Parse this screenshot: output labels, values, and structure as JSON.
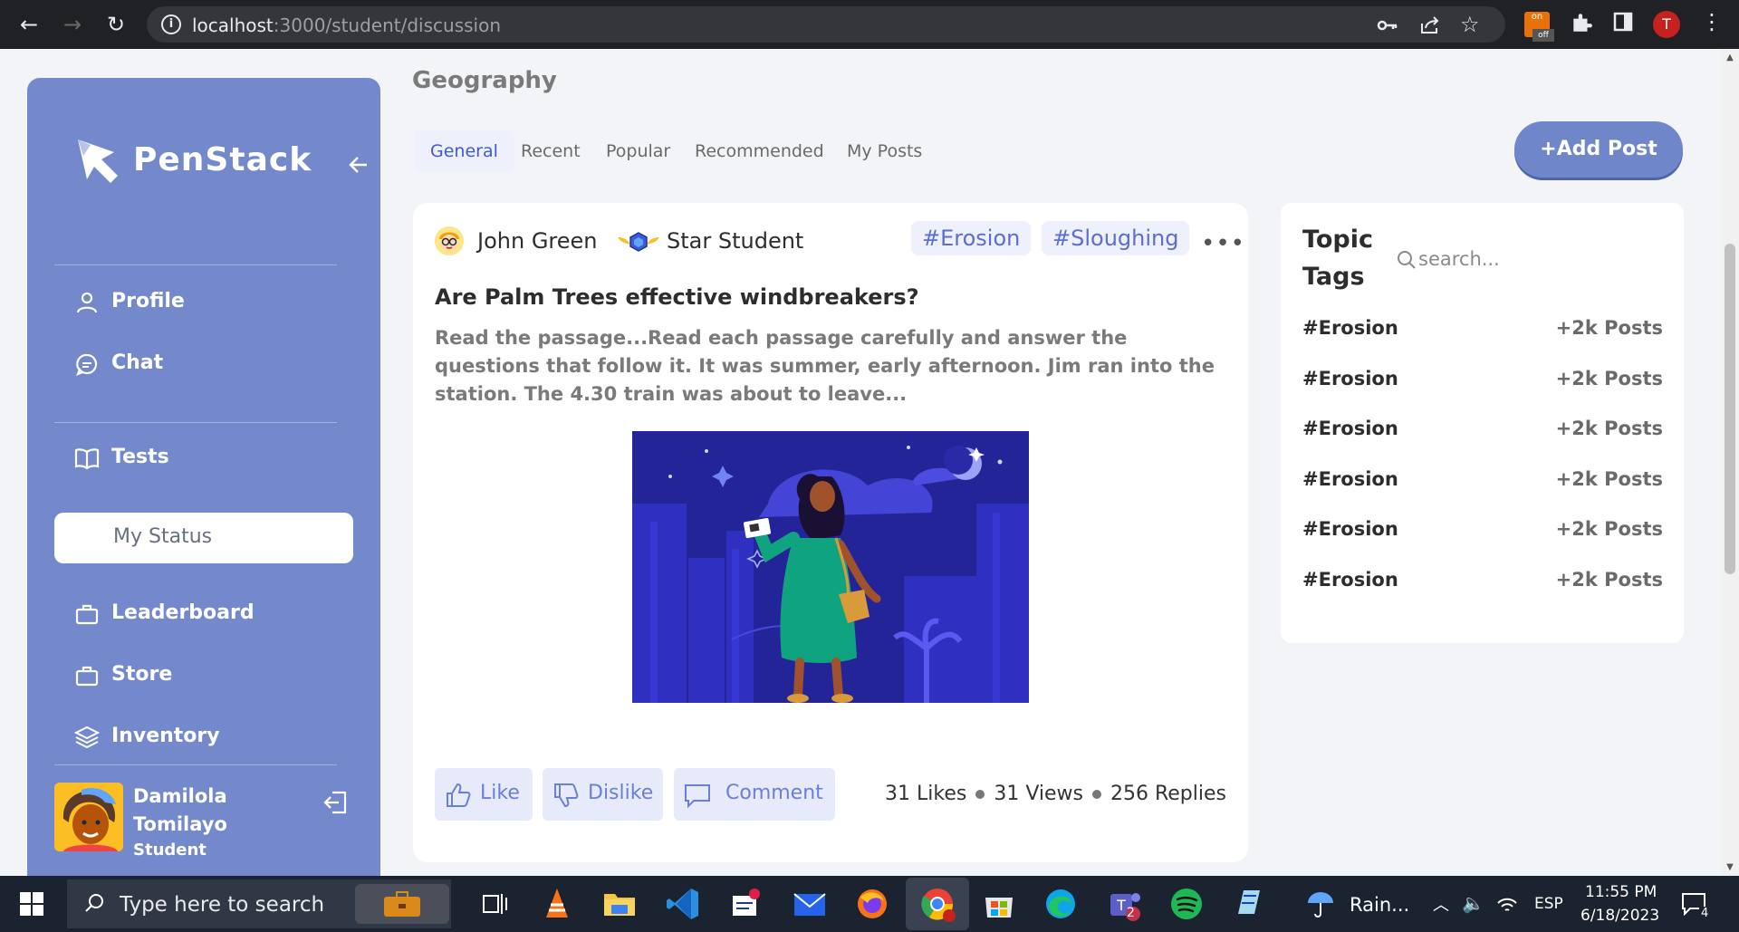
{
  "browser": {
    "url_host": "localhost",
    "url_path": ":3000/student/discussion"
  },
  "sidebar": {
    "brand": "PenStack",
    "items": [
      {
        "label": "Profile",
        "icon": "user-icon"
      },
      {
        "label": "Chat",
        "icon": "chat-icon"
      },
      {
        "label": "Tests",
        "icon": "book-icon"
      },
      {
        "label": "My Status",
        "icon": "",
        "active": true
      },
      {
        "label": "Leaderboard",
        "icon": "briefcase-icon"
      },
      {
        "label": "Store",
        "icon": "briefcase-icon"
      },
      {
        "label": "Inventory",
        "icon": "layers-icon"
      }
    ],
    "user": {
      "name": "Damilola Tomilayo",
      "role": "Student"
    }
  },
  "main": {
    "subject": "Geography",
    "tabs": [
      "General",
      "Recent",
      "Popular",
      "Recommended",
      "My Posts"
    ],
    "active_tab": "General",
    "add_post_label": "+Add Post"
  },
  "post": {
    "author": "John Green",
    "badge": "Star Student",
    "tags": [
      "#Erosion",
      "#Sloughing"
    ],
    "title": "Are Palm Trees effective windbreakers?",
    "body": "Read the passage...Read each passage carefully and answer the questions that follow it. It was summer, early afternoon. Jim ran into the station. The 4.30 train was about to leave...",
    "actions": {
      "like": "Like",
      "dislike": "Dislike",
      "comment": "Comment"
    },
    "stats": {
      "likes": "31 Likes",
      "views": "31 Views",
      "replies": "256 Replies"
    }
  },
  "topic_tags": {
    "title": "Topic Tags",
    "search_placeholder": "search...",
    "rows": [
      {
        "name": "#Erosion",
        "count": "+2k Posts"
      },
      {
        "name": "#Erosion",
        "count": "+2k Posts"
      },
      {
        "name": "#Erosion",
        "count": "+2k Posts"
      },
      {
        "name": "#Erosion",
        "count": "+2k Posts"
      },
      {
        "name": "#Erosion",
        "count": "+2k Posts"
      },
      {
        "name": "#Erosion",
        "count": "+2k Posts"
      }
    ]
  },
  "taskbar": {
    "search_placeholder": "Type here to search",
    "weather": "Rain...",
    "language": "ESP",
    "time": "11:55 PM",
    "date": "6/18/2023",
    "notifications": "4",
    "teams_badge": "2"
  },
  "colors": {
    "sidebar": "#7489cc",
    "accent": "#6f86c9",
    "tag_text": "#5b6ed2",
    "tab_active": "#3b5bdb"
  }
}
